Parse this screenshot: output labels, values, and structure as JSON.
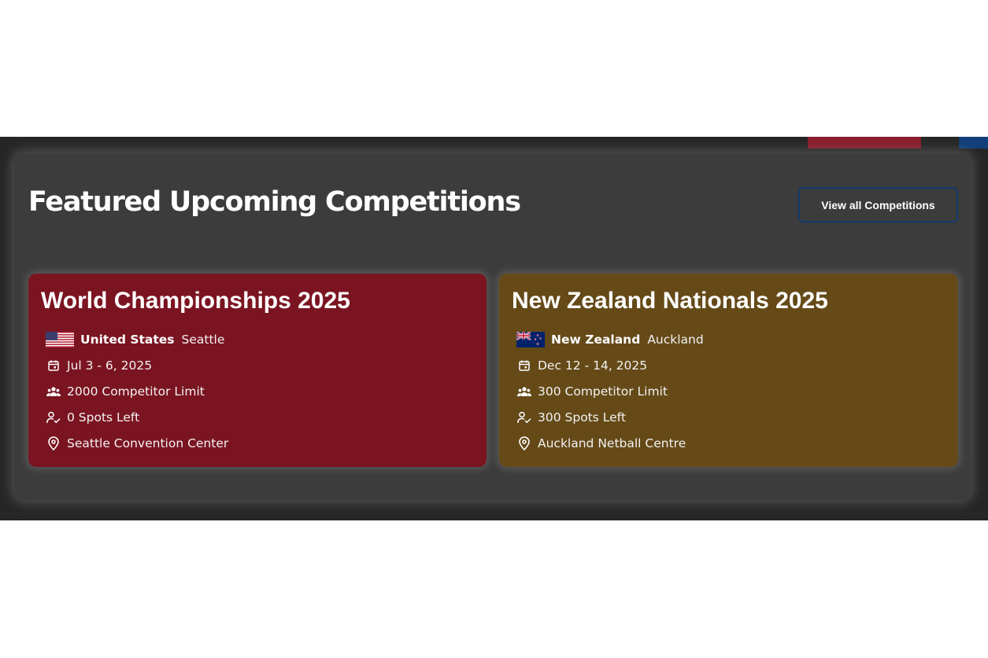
{
  "section": {
    "title": "Featured Upcoming Competitions",
    "view_all_label": "View all Competitions"
  },
  "colors": {
    "band_background": "#262626",
    "panel_background": "#3c3c3c",
    "card_1_background": "#7b1421",
    "card_2_background": "#654a18",
    "button_border": "#123a70",
    "accent_red": "#8a1d2b",
    "accent_blue": "#123f7a"
  },
  "competitions": [
    {
      "title": "World Championships 2025",
      "flag_icon": "us-flag-icon",
      "country": "United States",
      "city": "Seattle",
      "dates": "Jul 3 - 6, 2025",
      "competitor_limit": "2000 Competitor Limit",
      "spots_left": "0 Spots Left",
      "venue": "Seattle Convention Center"
    },
    {
      "title": "New Zealand Nationals 2025",
      "flag_icon": "nz-flag-icon",
      "country": "New Zealand",
      "city": "Auckland",
      "dates": "Dec 12 - 14, 2025",
      "competitor_limit": "300 Competitor Limit",
      "spots_left": "300 Spots Left",
      "venue": "Auckland Netball Centre"
    }
  ],
  "icons": {
    "dates": "calendar-icon",
    "competitor_limit": "group-icon",
    "spots_left": "person-check-icon",
    "venue": "location-pin-icon"
  }
}
